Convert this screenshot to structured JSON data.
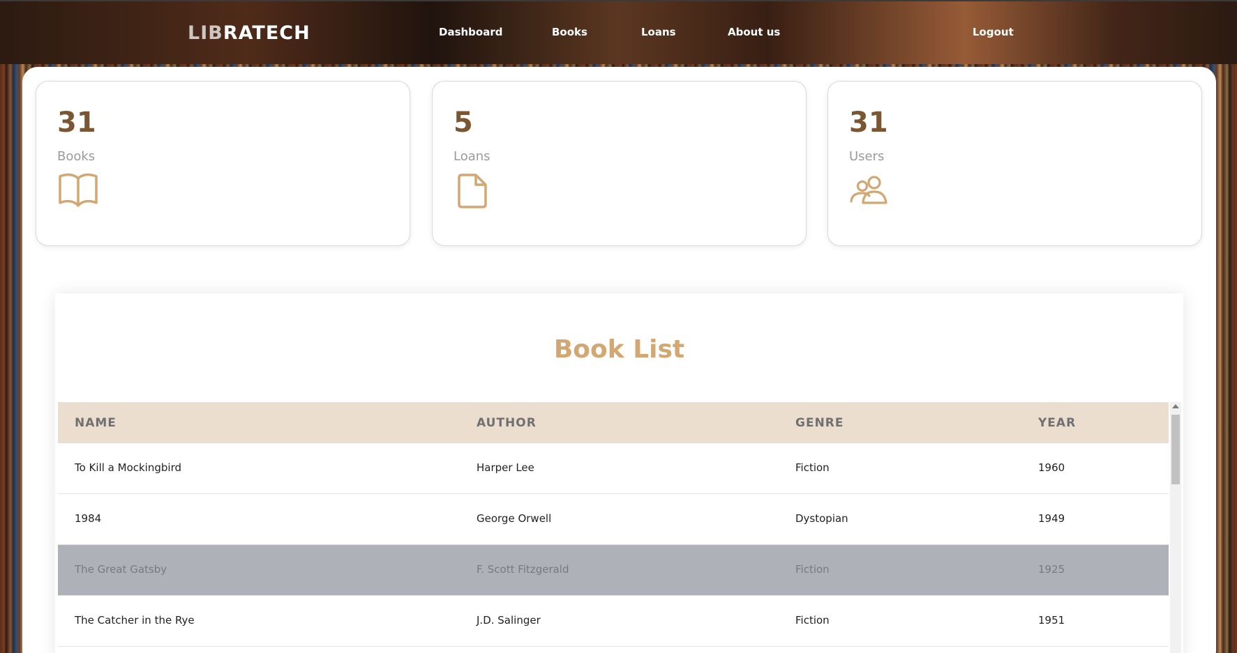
{
  "nav": {
    "logo_prefix": "LIB",
    "logo_suffix": "RATECH",
    "links": [
      "Dashboard",
      "Books",
      "Loans",
      "About us"
    ],
    "logout": "Logout"
  },
  "stats": [
    {
      "value": "31",
      "label": "Books",
      "icon": "open-book-icon"
    },
    {
      "value": "5",
      "label": "Loans",
      "icon": "document-icon"
    },
    {
      "value": "31",
      "label": "Users",
      "icon": "users-icon"
    }
  ],
  "book_list": {
    "title": "Book List",
    "columns": [
      "NAME",
      "AUTHOR",
      "GENRE",
      "YEAR"
    ],
    "rows": [
      {
        "name": "To Kill a Mockingbird",
        "author": "Harper Lee",
        "genre": "Fiction",
        "year": "1960"
      },
      {
        "name": "1984",
        "author": "George Orwell",
        "genre": "Dystopian",
        "year": "1949"
      },
      {
        "name": "The Great Gatsby",
        "author": "F. Scott Fitzgerald",
        "genre": "Fiction",
        "year": "1925"
      },
      {
        "name": "The Catcher in the Rye",
        "author": "J.D. Salinger",
        "genre": "Fiction",
        "year": "1951"
      }
    ],
    "selected_row": 2
  },
  "colors": {
    "accent": "#d2a771",
    "stat_number": "#7a5632",
    "header_bg": "#ebdecf",
    "selected_row": "#aeb1b8"
  }
}
